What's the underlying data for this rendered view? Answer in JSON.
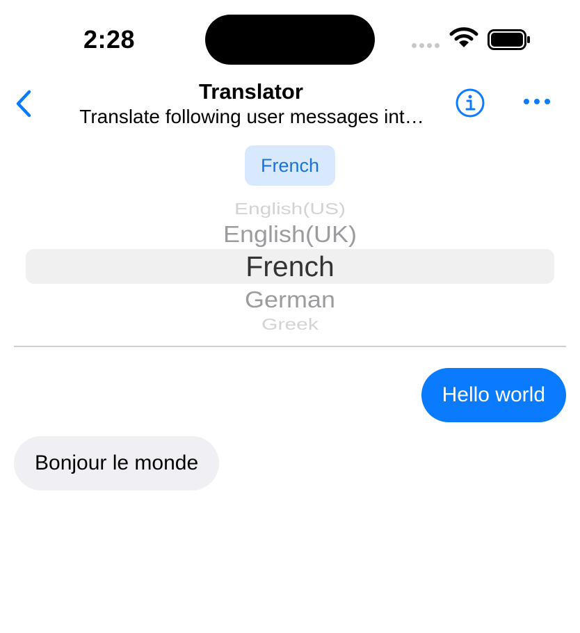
{
  "status_bar": {
    "time": "2:28",
    "icons": [
      "cellular-signal-icon",
      "wifi-icon",
      "battery-icon"
    ]
  },
  "nav": {
    "title": "Translator",
    "subtitle": "Translate following user messages int…",
    "back_icon": "chevron-left-icon",
    "info_icon": "info-circle-icon",
    "more_icon": "ellipsis-icon"
  },
  "language_chip": {
    "label": "French"
  },
  "picker": {
    "items": [
      "English(US)",
      "English(UK)",
      "French",
      "German",
      "Greek"
    ],
    "selected": "French"
  },
  "messages": [
    {
      "from": "user",
      "text": "Hello world"
    },
    {
      "from": "assistant",
      "text": "Bonjour le monde"
    }
  ],
  "colors": {
    "accent": "#0a7bff",
    "chip_background": "#d8e9fd",
    "incoming_bubble": "#efeff4"
  }
}
